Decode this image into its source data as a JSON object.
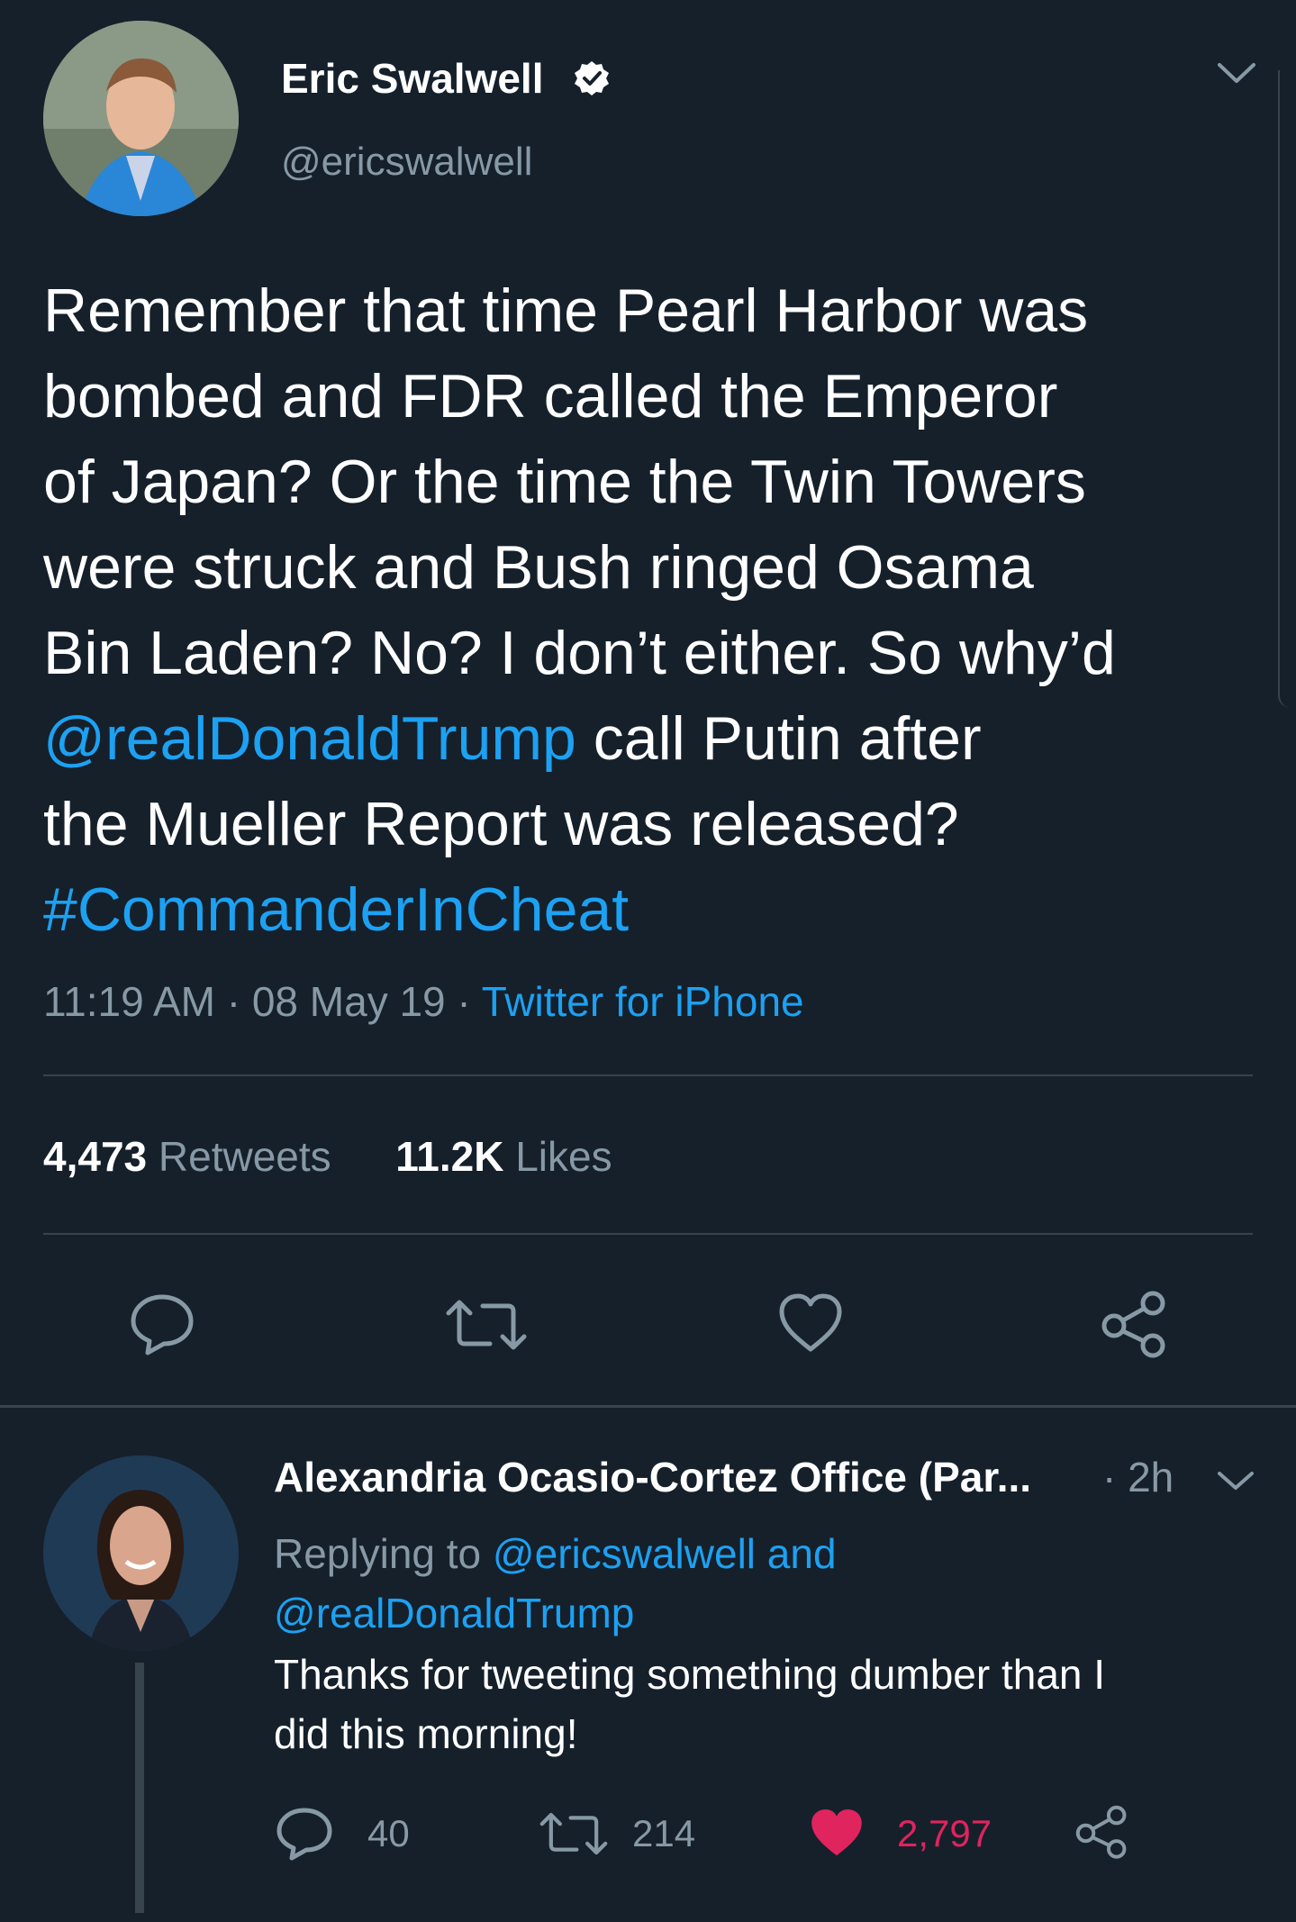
{
  "main_tweet": {
    "author_name": "Eric Swalwell",
    "author_handle": "@ericswalwell",
    "text_lines": [
      "Remember that time Pearl Harbor was",
      "bombed and FDR called the Emperor",
      "of Japan? Or the time the Twin Towers",
      "were struck and Bush ringed Osama",
      "Bin Laden? No? I don’t either. So why’d"
    ],
    "mention": "@realDonaldTrump",
    "text_after_mention": " call Putin after",
    "text_line_7": "the Mueller Report was released?",
    "hashtag": "#CommanderInCheat",
    "time": "11:19 AM",
    "sep1": " · ",
    "date": "08 May 19",
    "sep2": " · ",
    "source": "Twitter for iPhone",
    "retweets_count": "4,473",
    "retweets_label": "Retweets",
    "likes_count": "11.2K",
    "likes_label": "Likes"
  },
  "reply": {
    "author_name": "Alexandria Ocasio-Cortez Office (Par...",
    "age": "· 2h",
    "replying_to_label": "Replying to ",
    "replying_to_handles": "@ericswalwell and",
    "replying_to_handle2": "@realDonaldTrump",
    "text_line_1": "Thanks for tweeting something dumber than I",
    "text_line_2": "did this morning!",
    "reply_count": "40",
    "retweet_count": "214",
    "like_count": "2,797"
  },
  "colors": {
    "background": "#15202b",
    "accent": "#1da1f2",
    "muted": "#8899a6",
    "like": "#e0245e",
    "divider": "#38444d"
  }
}
